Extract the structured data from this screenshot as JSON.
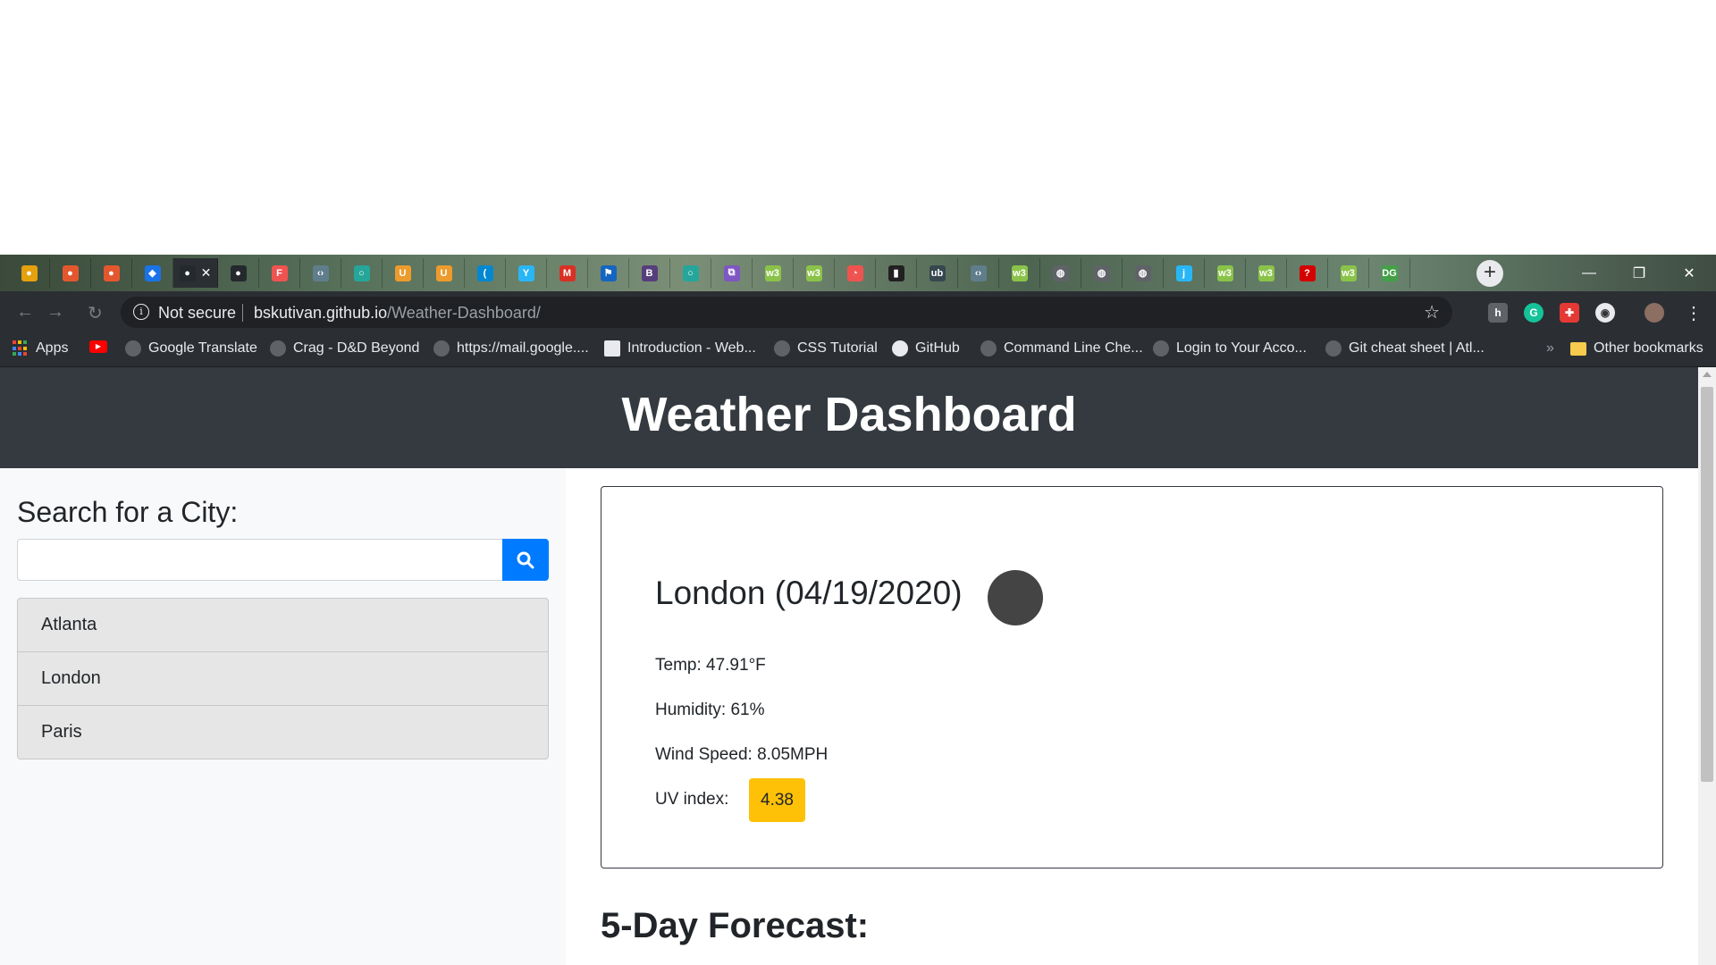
{
  "browser": {
    "tabs": [
      {
        "icon": "plex-icon",
        "color": "#e5a00d",
        "glyph": "●"
      },
      {
        "icon": "red-circle-icon",
        "color": "#e4572e",
        "glyph": "●"
      },
      {
        "icon": "red-circle-icon",
        "color": "#e4572e",
        "glyph": "●"
      },
      {
        "icon": "cap-icon",
        "color": "#1a73e8",
        "glyph": "◆"
      },
      {
        "icon": "github-icon",
        "color": "#24292e",
        "glyph": "●"
      },
      {
        "icon": "github-icon",
        "color": "#24292e",
        "glyph": "●"
      },
      {
        "icon": "f-icon",
        "color": "#ef5350",
        "glyph": "F"
      },
      {
        "icon": "code-icon",
        "color": "#607d8b",
        "glyph": "‹›"
      },
      {
        "icon": "circle-icon",
        "color": "#26a69a",
        "glyph": "○"
      },
      {
        "icon": "udemy-icon",
        "color": "#ec9b2c",
        "glyph": "U"
      },
      {
        "icon": "udemy-icon",
        "color": "#ec9b2c",
        "glyph": "U"
      },
      {
        "icon": "wave-icon",
        "color": "#0288d1",
        "glyph": "("
      },
      {
        "icon": "y-icon",
        "color": "#29b6f6",
        "glyph": "Y"
      },
      {
        "icon": "gmail-icon",
        "color": "#d93025",
        "glyph": "M"
      },
      {
        "icon": "flag-icon",
        "color": "#1565c0",
        "glyph": "⚑"
      },
      {
        "icon": "bootstrap-icon",
        "color": "#563d7c",
        "glyph": "B"
      },
      {
        "icon": "circle-icon",
        "color": "#26a69a",
        "glyph": "○"
      },
      {
        "icon": "clip-icon",
        "color": "#7e57c2",
        "glyph": "⧉"
      },
      {
        "icon": "w3-icon",
        "color": "#8bc34a",
        "glyph": "w3"
      },
      {
        "icon": "w3-icon",
        "color": "#8bc34a",
        "glyph": "w3"
      },
      {
        "icon": "clock-icon",
        "color": "#ef5350",
        "glyph": "◔"
      },
      {
        "icon": "doc-icon",
        "color": "#212121",
        "glyph": "▮"
      },
      {
        "icon": "ub-icon",
        "color": "#37474f",
        "glyph": "ub"
      },
      {
        "icon": "code-icon",
        "color": "#607d8b",
        "glyph": "‹›"
      },
      {
        "icon": "w3-icon",
        "color": "#8bc34a",
        "glyph": "w3"
      },
      {
        "icon": "globe-icon",
        "color": "#5f6368",
        "glyph": "◍"
      },
      {
        "icon": "globe-icon",
        "color": "#5f6368",
        "glyph": "◍"
      },
      {
        "icon": "globe-icon",
        "color": "#5f6368",
        "glyph": "◍"
      },
      {
        "icon": "j-icon",
        "color": "#29b6f6",
        "glyph": "j"
      },
      {
        "icon": "w3-icon",
        "color": "#8bc34a",
        "glyph": "w3"
      },
      {
        "icon": "w3-icon",
        "color": "#8bc34a",
        "glyph": "w3"
      },
      {
        "icon": "help-icon",
        "color": "#d50000",
        "glyph": "?"
      },
      {
        "icon": "w3-icon",
        "color": "#8bc34a",
        "glyph": "w3"
      },
      {
        "icon": "dg-icon",
        "color": "#43a047",
        "glyph": "DG"
      }
    ],
    "active_tab_index": 4,
    "address": {
      "security_label": "Not secure",
      "host": "bskutivan.github.io",
      "path": "/Weather-Dashboard/"
    },
    "bookmarks": [
      {
        "label": "Apps",
        "icon": "apps-icon"
      },
      {
        "label": "",
        "icon": "youtube-icon"
      },
      {
        "label": "Google Translate",
        "icon": "globe-icon"
      },
      {
        "label": "Crag - D&D Beyond",
        "icon": "globe-icon"
      },
      {
        "label": "https://mail.google....",
        "icon": "globe-icon"
      },
      {
        "label": "Introduction - Web...",
        "icon": "page-icon"
      },
      {
        "label": "CSS Tutorial",
        "icon": "globe-icon"
      },
      {
        "label": "GitHub",
        "icon": "github-icon"
      },
      {
        "label": "Command Line Che...",
        "icon": "globe-icon"
      },
      {
        "label": "Login to Your Acco...",
        "icon": "globe-icon"
      },
      {
        "label": "Git cheat sheet | Atl...",
        "icon": "globe-icon"
      }
    ],
    "overflow_label": "»",
    "other_bookmarks": "Other bookmarks"
  },
  "page": {
    "title": "Weather Dashboard",
    "search": {
      "heading": "Search for a City:",
      "value": "",
      "placeholder": ""
    },
    "cities": [
      "Atlanta",
      "London",
      "Paris"
    ],
    "current": {
      "city_date": "London (04/19/2020)",
      "temp": "Temp: 47.91°F",
      "humidity": "Humidity: 61%",
      "wind": "Wind Speed: 8.05MPH",
      "uv_label": "UV index:",
      "uv_value": "4.38",
      "uv_color": "#ffc107"
    },
    "forecast_title": "5-Day Forecast:"
  },
  "colors": {
    "header_bg": "#343a40",
    "search_button": "#007bff",
    "sidebar_bg": "#f8f9fa"
  }
}
